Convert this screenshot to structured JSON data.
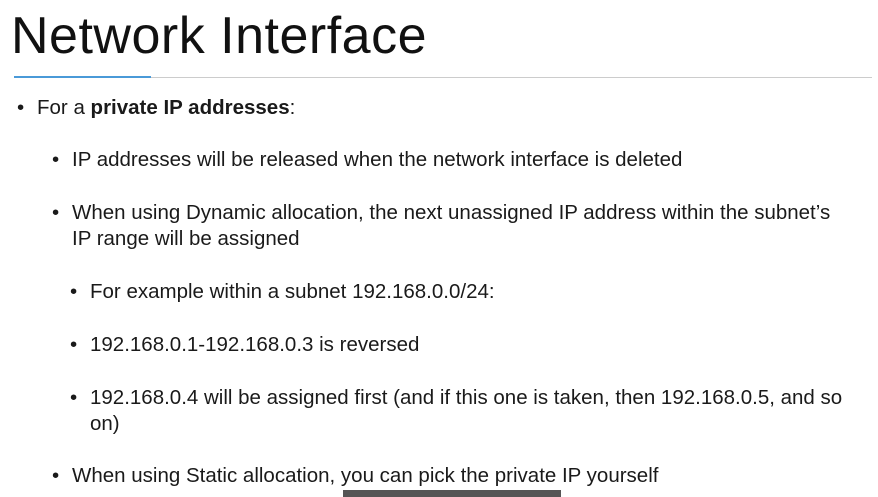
{
  "slide": {
    "title": "Network Interface",
    "bullets": [
      {
        "level": 1,
        "prefix": "For a ",
        "bold": "private IP addresses",
        "suffix": ":"
      },
      {
        "level": 2,
        "text": "IP addresses will be released when the network interface is deleted"
      },
      {
        "level": 2,
        "text": "When using Dynamic allocation, the next unassigned IP address within the subnet’s IP range will be assigned"
      },
      {
        "level": 3,
        "text": "For example within a subnet 192.168.0.0/24:"
      },
      {
        "level": 3,
        "text": "192.168.0.1-192.168.0.3 is reversed"
      },
      {
        "level": 3,
        "text": "192.168.0.4 will be assigned first (and if this one is taken, then 192.168.0.5, and so on)"
      },
      {
        "level": 2,
        "text": "When using Static allocation, you can pick the private IP yourself"
      }
    ],
    "bullet_glyph": "•",
    "accent_color": "#4a9ad8"
  }
}
